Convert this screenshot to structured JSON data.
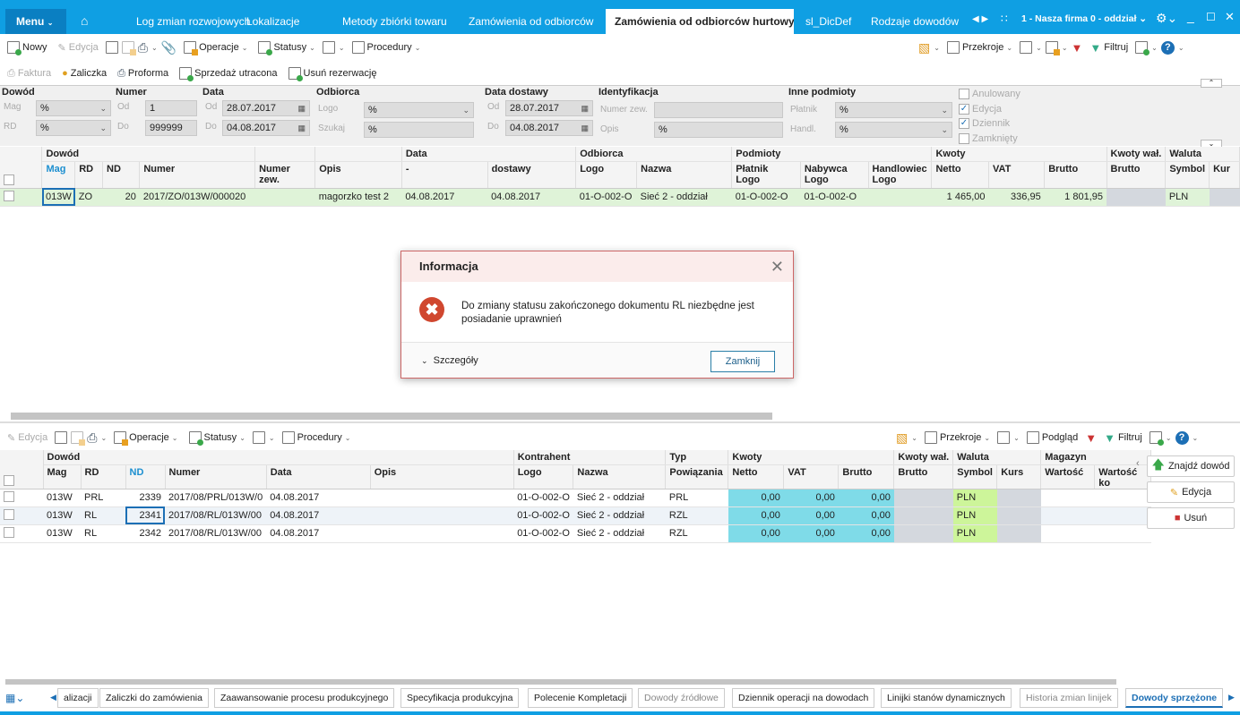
{
  "titlebar": {
    "menu": "Menu",
    "tabs": [
      "Log zmian rozwojowych",
      "Lokalizacje",
      "Metody zbiórki towaru",
      "Zamówienia od odbiorców",
      "Zamówienia od odbiorców hurtowy",
      "sl_DicDef",
      "Rodzaje dowodów"
    ],
    "active_tab": 4,
    "company": "1 - Nasza firma 0 - oddział"
  },
  "toolbar1": {
    "left": [
      "Nowy",
      "Edycja",
      "Operacje",
      "Statusy",
      "Procedury"
    ],
    "right": [
      "Przekroje",
      "Filtruj"
    ]
  },
  "toolbar2": [
    "Faktura",
    "Zaliczka",
    "Proforma",
    "Sprzedaż utracona",
    "Usuń rezerwację"
  ],
  "filter": {
    "dowod": {
      "label": "Dowód",
      "mag_label": "Mag",
      "mag": "%",
      "rd_label": "RD",
      "rd": "%"
    },
    "numer": {
      "label": "Numer",
      "od_label": "Od",
      "od": "1",
      "do_label": "Do",
      "do": "999999"
    },
    "data": {
      "label": "Data",
      "od_label": "Od",
      "od": "28.07.2017",
      "do_label": "Do",
      "do": "04.08.2017"
    },
    "odbiorca": {
      "label": "Odbiorca",
      "logo_label": "Logo",
      "logo": "%",
      "szukaj_label": "Szukaj",
      "szukaj": "%"
    },
    "data_dostawy": {
      "label": "Data dostawy",
      "od_label": "Od",
      "od": "28.07.2017",
      "do_label": "Do",
      "do": "04.08.2017"
    },
    "identyfikacja": {
      "label": "Identyfikacja",
      "numer_zew_label": "Numer zew.",
      "numer_zew": "",
      "opis_label": "Opis",
      "opis": "%"
    },
    "inne": {
      "label": "Inne podmioty",
      "platnik_label": "Płatnik",
      "platnik": "%",
      "handl_label": "Handl.",
      "handl": "%"
    },
    "checks": [
      {
        "label": "Anulowany",
        "checked": false
      },
      {
        "label": "Edycja",
        "checked": true
      },
      {
        "label": "Dziennik",
        "checked": true
      },
      {
        "label": "Zamknięty",
        "checked": false
      }
    ]
  },
  "top_grid": {
    "groups": [
      [
        "Dowód",
        4
      ],
      [
        "",
        1
      ],
      [
        "",
        1
      ],
      [
        "Data",
        2
      ],
      [
        "Odbiorca",
        2
      ],
      [
        "Podmioty",
        3
      ],
      [
        "Kwoty",
        3
      ],
      [
        "Kwoty wał.",
        1
      ],
      [
        "Waluta",
        2
      ]
    ],
    "columns": [
      "Mag",
      "RD",
      "ND",
      "Numer",
      "Numer zew.",
      "Opis",
      "-",
      "dostawy",
      "Logo",
      "Nazwa",
      "Płatnik\nLogo",
      "Nabywca\nLogo",
      "Handlowiec\nLogo",
      "Netto",
      "VAT",
      "Brutto",
      "Brutto",
      "Symbol",
      "Kur"
    ],
    "rows": [
      [
        "013W",
        "ZO",
        "20",
        "2017/ZO/013W/000020",
        "",
        "magorzko test 2",
        "04.08.2017",
        "04.08.2017",
        "01-O-002-O",
        "Sieć 2 - oddział",
        "01-O-002-O",
        "01-O-002-O",
        "",
        "1 465,00",
        "336,95",
        "1 801,95",
        "",
        "PLN",
        ""
      ]
    ]
  },
  "dialog": {
    "title": "Informacja",
    "message": "Do zmiany statusu zakończonego dokumentu RL niezbędne jest posiadanie uprawnień",
    "details": "Szczegóły",
    "close": "Zamknij"
  },
  "toolbar3": {
    "left": [
      "Edycja",
      "Operacje",
      "Statusy",
      "Procedury"
    ],
    "right": [
      "Przekroje",
      "Podgląd",
      "Filtruj"
    ]
  },
  "bottom_grid": {
    "groups": [
      [
        "Dowód",
        6
      ],
      [
        "Kontrahent",
        2
      ],
      [
        "Typ",
        1
      ],
      [
        "Kwoty",
        3
      ],
      [
        "Kwoty wał.",
        1
      ],
      [
        "Waluta",
        2
      ],
      [
        "Magazyn",
        2
      ]
    ],
    "columns": [
      "Mag",
      "RD",
      "ND",
      "Numer",
      "Data",
      "Opis",
      "Logo",
      "Nazwa",
      "Powiązania",
      "Netto",
      "VAT",
      "Brutto",
      "Brutto",
      "Symbol",
      "Kurs",
      "Wartość",
      "Wartość ko"
    ],
    "rows": [
      [
        "013W",
        "PRL",
        "2339",
        "2017/08/PRL/013W/0",
        "04.08.2017",
        "",
        "01-O-002-O",
        "Sieć 2 - oddział",
        "PRL",
        "0,00",
        "0,00",
        "0,00",
        "",
        "PLN",
        "",
        "",
        ""
      ],
      [
        "013W",
        "RL",
        "2341",
        "2017/08/RL/013W/00",
        "04.08.2017",
        "",
        "01-O-002-O",
        "Sieć 2 - oddział",
        "RZL",
        "0,00",
        "0,00",
        "0,00",
        "",
        "PLN",
        "",
        "",
        ""
      ],
      [
        "013W",
        "RL",
        "2342",
        "2017/08/RL/013W/00",
        "04.08.2017",
        "",
        "01-O-002-O",
        "Sieć 2 - oddział",
        "RZL",
        "0,00",
        "0,00",
        "0,00",
        "",
        "PLN",
        "",
        "",
        ""
      ]
    ]
  },
  "side_buttons": [
    "Znajdź dowód",
    "Edycja",
    "Usuń"
  ],
  "bottom_tabs": [
    "alizacji",
    "Zaliczki do zamówienia",
    "Zaawansowanie procesu produkcyjnego",
    "Specyfikacja produkcyjna",
    "Polecenie Kompletacji",
    "Dowody źródłowe",
    "Dziennik operacji na dowodach",
    "Linijki stanów dynamicznych",
    "Historia zmian linijek",
    "Dowody sprzężone"
  ],
  "colors": {
    "accent": "#0f9fe3",
    "row_selected": "#dff3d8",
    "kwoty_cell": "#7fdbe8",
    "pln_cell": "#cdf59a",
    "grey_cell": "#d4d8de"
  }
}
